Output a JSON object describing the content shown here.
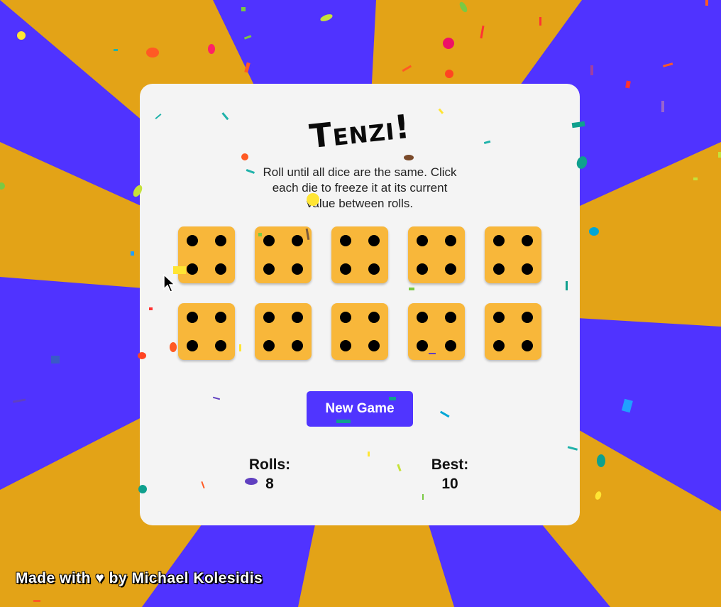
{
  "theme": {
    "background_primary": "#5033ff",
    "background_stripe": "#e3a317",
    "card": "#f4f4f4",
    "die": "#f8b73a",
    "button": "#5035ff"
  },
  "game": {
    "title": "Tenzi!",
    "instructions": "Roll until all dice are the same. Click each die to freeze it at its current value between rolls.",
    "dice": [
      4,
      4,
      4,
      4,
      4,
      4,
      4,
      4,
      4,
      4
    ],
    "new_game_label": "New Game",
    "rolls_label": "Rolls:",
    "rolls_value": "8",
    "best_label": "Best:",
    "best_value": "10"
  },
  "footer": {
    "credit": "Made with ♥ by Michael Kolesidis"
  }
}
